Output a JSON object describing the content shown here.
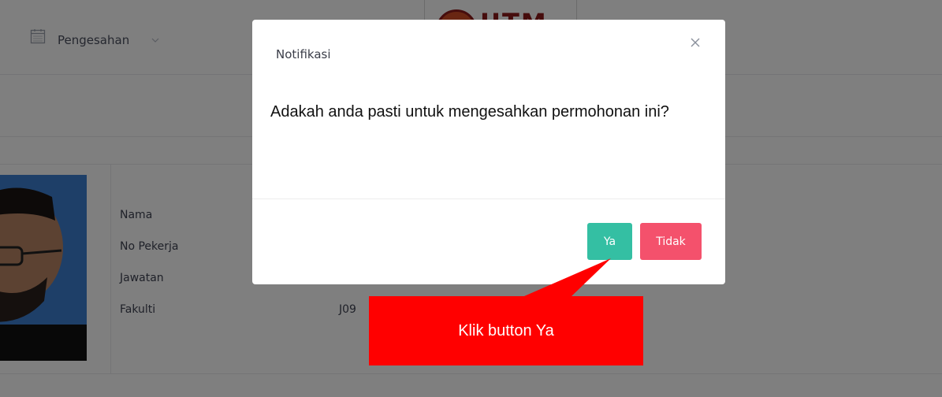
{
  "nav": {
    "menu_label": "Pengesahan"
  },
  "logo": {
    "text": "UTM"
  },
  "profile": {
    "labels": {
      "name": "Nama",
      "staff_no": "No Pekerja",
      "position": "Jawatan",
      "faculty": "Fakulti"
    },
    "faculty_value_partial": "J09"
  },
  "modal": {
    "title": "Notifikasi",
    "message": "Adakah anda pasti untuk mengesahkan permohonan ini?",
    "confirm_label": "Ya",
    "cancel_label": "Tidak"
  },
  "annotation": {
    "text": "Klik button Ya"
  },
  "colors": {
    "confirm": "#34bfa3",
    "cancel": "#f4516c",
    "callout": "#ff0000",
    "overlay": "rgba(0,0,0,0.5)"
  },
  "icons": {
    "nav": "calendar-icon",
    "nav_caret": "chevron-down-icon",
    "close": "close-icon"
  }
}
